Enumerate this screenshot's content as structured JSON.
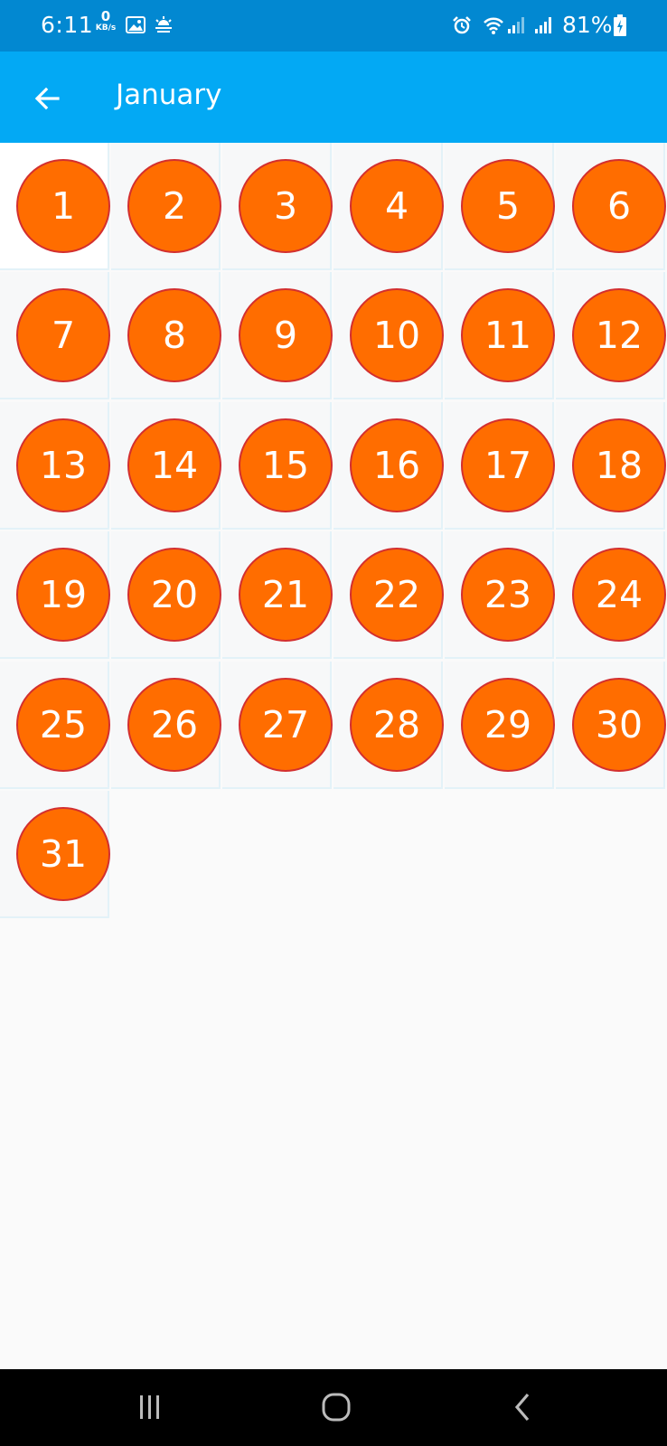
{
  "status_bar": {
    "time": "6:11",
    "net_speed_value": "0",
    "net_speed_unit": "KB/s",
    "battery_percent": "81%",
    "icons": [
      "gallery-icon",
      "weather-icon",
      "alarm-icon",
      "wifi-icon",
      "signal-icon",
      "signal-icon",
      "battery-charging-icon"
    ]
  },
  "app_bar": {
    "title": "January",
    "back_icon": "arrow-left-icon"
  },
  "calendar": {
    "month": "January",
    "days": [
      "1",
      "2",
      "3",
      "4",
      "5",
      "6",
      "7",
      "8",
      "9",
      "10",
      "11",
      "12",
      "13",
      "14",
      "15",
      "16",
      "17",
      "18",
      "19",
      "20",
      "21",
      "22",
      "23",
      "24",
      "25",
      "26",
      "27",
      "28",
      "29",
      "30",
      "31"
    ],
    "circle_color": "#ff6d00",
    "circle_border_color": "#d32f2f"
  },
  "nav_bar": {
    "buttons": [
      "recent-apps-icon",
      "home-icon",
      "back-icon"
    ]
  },
  "colors": {
    "status_bar": "#0288d1",
    "app_bar": "#03a9f4",
    "background": "#fafafa",
    "nav_bar": "#000000"
  }
}
